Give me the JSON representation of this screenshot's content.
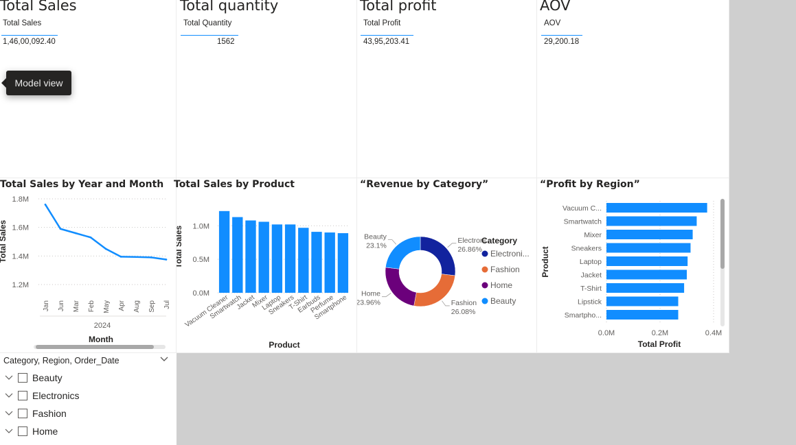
{
  "kpis": [
    {
      "title": "Total Sales",
      "header": "Total Sales",
      "value": "1,46,00,092.40"
    },
    {
      "title": "Total quantity",
      "header": "Total Quantity",
      "value": "1562"
    },
    {
      "title": "Total profit",
      "header": "Total Profit",
      "value": "43,95,203.41"
    },
    {
      "title": "AOV",
      "header": "AOV",
      "value": "29,200.18"
    }
  ],
  "tooltip": {
    "text": "Model view"
  },
  "slicer": {
    "header": "Category, Region, Order_Date",
    "items": [
      {
        "label": "Beauty"
      },
      {
        "label": "Electronics"
      },
      {
        "label": "Fashion"
      },
      {
        "label": "Home"
      }
    ]
  },
  "colors": {
    "accent": "#118dff",
    "electronics": "#12239e",
    "fashion": "#e66c37",
    "home": "#6b007b",
    "beauty": "#118dff"
  },
  "chart_data": [
    {
      "type": "line",
      "title": "Total Sales by Year and Month",
      "xlabel": "Month",
      "ylabel": "Total Sales",
      "year_label": "2024",
      "x": [
        "Jan",
        "Jun",
        "Mar",
        "Feb",
        "May",
        "Apr",
        "Aug",
        "Sep",
        "Jul"
      ],
      "y": [
        1.76,
        1.59,
        1.56,
        1.53,
        1.45,
        1.395,
        1.393,
        1.39,
        1.375
      ],
      "y_ticks": [
        "1.2M",
        "1.4M",
        "1.6M",
        "1.8M"
      ],
      "ylim": [
        1.2,
        1.8
      ],
      "grid": true
    },
    {
      "type": "bar",
      "title": "Total Sales by Product",
      "xlabel": "Product",
      "ylabel": "Total Sales",
      "categories": [
        "Vacuum Cleaner",
        "Smartwatch",
        "Jacket",
        "Mixer",
        "Laptop",
        "Sneakers",
        "T-Shirt",
        "Earbuds",
        "Perfume",
        "Smartphone"
      ],
      "values": [
        1.22,
        1.13,
        1.08,
        1.06,
        1.02,
        1.02,
        0.97,
        0.91,
        0.9,
        0.89
      ],
      "y_ticks": [
        "0.0M",
        "0.5M",
        "1.0M"
      ],
      "ylim": [
        0,
        1.3
      ],
      "grid": true
    },
    {
      "type": "pie",
      "title": "“Revenue by Category”",
      "legend_title": "Category",
      "legend_position": "right",
      "slices": [
        {
          "label": "Electroni...",
          "legend": "Electroni...",
          "percent_label": "26.86%",
          "value": 26.86,
          "color": "#12239e"
        },
        {
          "label": "Fashion",
          "legend": "Fashion",
          "percent_label": "26.08%",
          "value": 26.08,
          "color": "#e66c37"
        },
        {
          "label": "Home",
          "legend": "Home",
          "percent_label": "23.96%",
          "value": 23.96,
          "color": "#6b007b"
        },
        {
          "label": "Beauty",
          "legend": "Beauty",
          "percent_label": "23.1%",
          "value": 23.1,
          "color": "#118dff"
        }
      ]
    },
    {
      "type": "bar",
      "orientation": "horizontal",
      "title": "“Profit by Region”",
      "xlabel": "Total Profit",
      "ylabel": "Product",
      "categories": [
        "Vacuum C...",
        "Smartwatch",
        "Mixer",
        "Sneakers",
        "Laptop",
        "Jacket",
        "T-Shirt",
        "Lipstick",
        "Smartpho..."
      ],
      "values": [
        0.376,
        0.337,
        0.322,
        0.314,
        0.303,
        0.3,
        0.29,
        0.268,
        0.268
      ],
      "x_ticks": [
        "0.0M",
        "0.2M",
        "0.4M"
      ],
      "xlim": [
        0,
        0.4
      ],
      "grid": true
    }
  ]
}
